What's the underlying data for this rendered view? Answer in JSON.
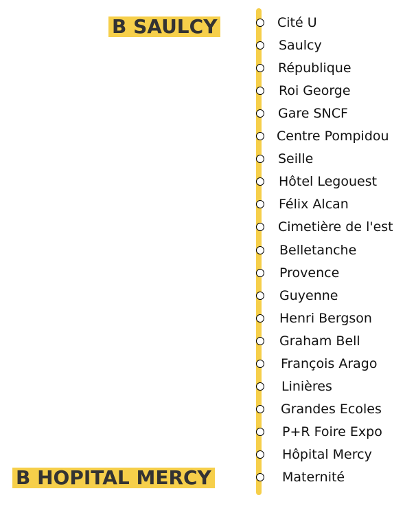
{
  "line": {
    "color": "#f6cf4a",
    "terminus_top": "B SAULCY",
    "terminus_bottom": "B HOPITAL MERCY"
  },
  "stops": [
    {
      "name": "Cité U"
    },
    {
      "name": "Saulcy"
    },
    {
      "name": "République"
    },
    {
      "name": "Roi George"
    },
    {
      "name": "Gare SNCF"
    },
    {
      "name": "Centre Pompidou"
    },
    {
      "name": "Seille"
    },
    {
      "name": "Hôtel Legouest"
    },
    {
      "name": "Félix Alcan"
    },
    {
      "name": "Cimetière de l'est"
    },
    {
      "name": "Belletanche"
    },
    {
      "name": "Provence"
    },
    {
      "name": "Guyenne"
    },
    {
      "name": "Henri Bergson"
    },
    {
      "name": "Graham Bell"
    },
    {
      "name": "François Arago"
    },
    {
      "name": "Linières"
    },
    {
      "name": "Grandes Ecoles"
    },
    {
      "name": "P+R Foire Expo"
    },
    {
      "name": "Hôpital Mercy"
    },
    {
      "name": "Maternité"
    }
  ]
}
